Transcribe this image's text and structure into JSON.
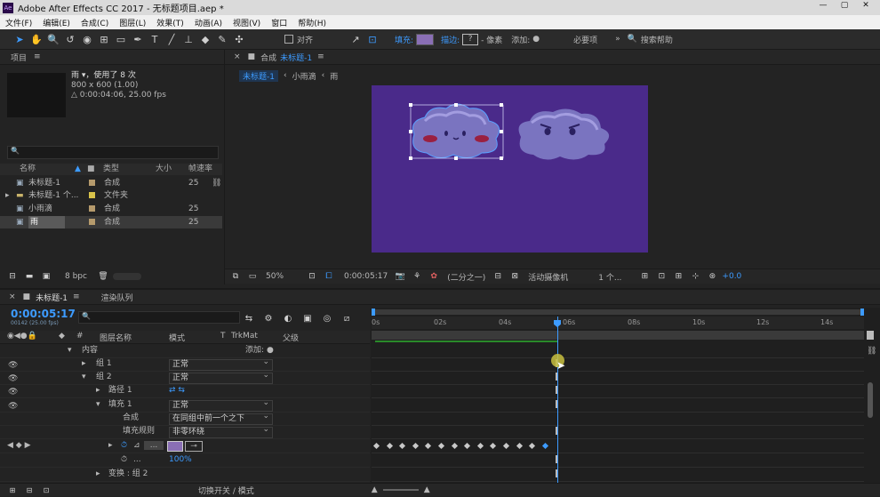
{
  "window": {
    "title": "Adobe After Effects CC 2017 - 无标题项目.aep *"
  },
  "menu": [
    "文件(F)",
    "编辑(E)",
    "合成(C)",
    "图层(L)",
    "效果(T)",
    "动画(A)",
    "视图(V)",
    "窗口",
    "帮助(H)"
  ],
  "toolbar": {
    "snap_label": "对齐",
    "fill_label": "填充:",
    "stroke_label": "描边:",
    "stroke_unit": "- 像素",
    "add_label": "添加:",
    "workspace": "必要项",
    "search_help": "搜索帮助",
    "fill_color": "#8a6fb5"
  },
  "project": {
    "tab": "项目",
    "asset_name": "雨 ▾，使用了 8 次",
    "asset_size": "800 x 600 (1.00)",
    "asset_duration": "△ 0:00:04:06, 25.00 fps",
    "columns": {
      "name": "名称",
      "type": "类型",
      "size": "大小",
      "fps": "帧速率"
    },
    "items": [
      {
        "name": "未标题-1",
        "type": "合成",
        "fps": "25",
        "color": "#b59a6c"
      },
      {
        "name": "未标题-1 个...",
        "type": "文件夹",
        "fps": "",
        "color": "#d8c24a"
      },
      {
        "name": "小雨滴",
        "type": "合成",
        "fps": "25",
        "color": "#b59a6c"
      },
      {
        "name": "雨",
        "type": "合成",
        "fps": "25",
        "color": "#b59a6c"
      }
    ],
    "bpc": "8 bpc"
  },
  "comp": {
    "tab_label": "合成",
    "tab_name": "未标题-1",
    "breadcrumb": [
      "未标题-1",
      "小雨滴",
      "雨"
    ],
    "zoom": "50%",
    "timecode": "0:00:05:17",
    "resolution": "(二分之一)",
    "camera": "活动摄像机",
    "views": "1 个...",
    "exposure": "+0.0",
    "bg_color": "#4a2a8a"
  },
  "timeline": {
    "tab": "未标题-1",
    "render_queue": "渲染队列",
    "current_time": "0:00:05:17",
    "frame_info": "00142 (25.00 fps)",
    "columns": {
      "layer_name": "图层名称",
      "mode": "模式",
      "t": "T",
      "trkmat": "TrkMat",
      "parent": "父级"
    },
    "ruler": [
      "0s",
      "02s",
      "04s",
      "06s",
      "08s",
      "10s",
      "12s",
      "14s"
    ],
    "footer_toggle": "切换开关 / 模式",
    "rows": {
      "content": "内容",
      "content_add": "添加:",
      "group1": "组 1",
      "group1_mode": "正常",
      "group2": "组 2",
      "group2_mode": "正常",
      "path1": "路径 1",
      "fill1": "填充 1",
      "fill1_mode": "正常",
      "composite": "合成",
      "composite_val": "在同组中前一个之下",
      "fill_rule": "填充规则",
      "fill_rule_val": "非零环绕",
      "opacity_val": "100%",
      "transform": "变换 : 组 2"
    }
  }
}
